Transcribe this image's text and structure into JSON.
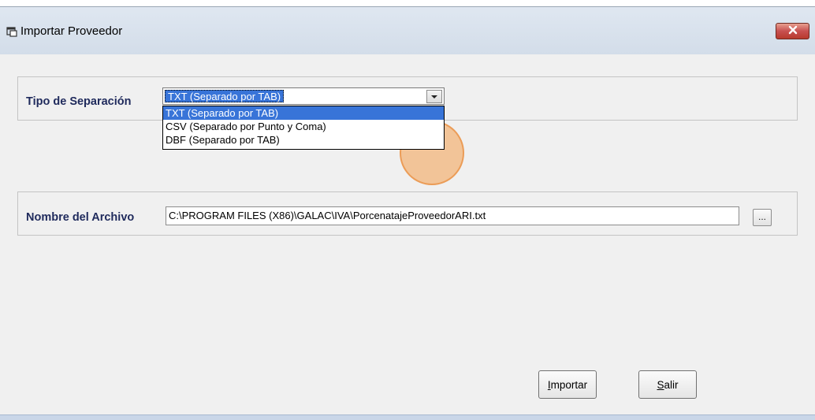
{
  "window": {
    "title": "Importar Proveedor",
    "close_label": "x"
  },
  "separation": {
    "label": "Tipo de Separación",
    "selected": "TXT (Separado por TAB)",
    "options": [
      "TXT (Separado por TAB)",
      "CSV (Separado por Punto y Coma)",
      "DBF (Separado por TAB)"
    ]
  },
  "file": {
    "label": "Nombre del Archivo",
    "value": "C:\\PROGRAM FILES (X86)\\GALAC\\IVA\\PorcenatajeProveedorARI.txt",
    "browse_label": "..."
  },
  "buttons": {
    "import_first": "I",
    "import_rest": "mportar",
    "exit_first": "S",
    "exit_rest": "alir"
  },
  "colors": {
    "selection": "#3874d8",
    "highlight": "#f4a050",
    "label_text": "#1f2a5c",
    "close_button": "#c75050"
  },
  "icons": {
    "app": "app-window-icon",
    "close": "close-icon",
    "dropdown": "chevron-down-icon"
  }
}
